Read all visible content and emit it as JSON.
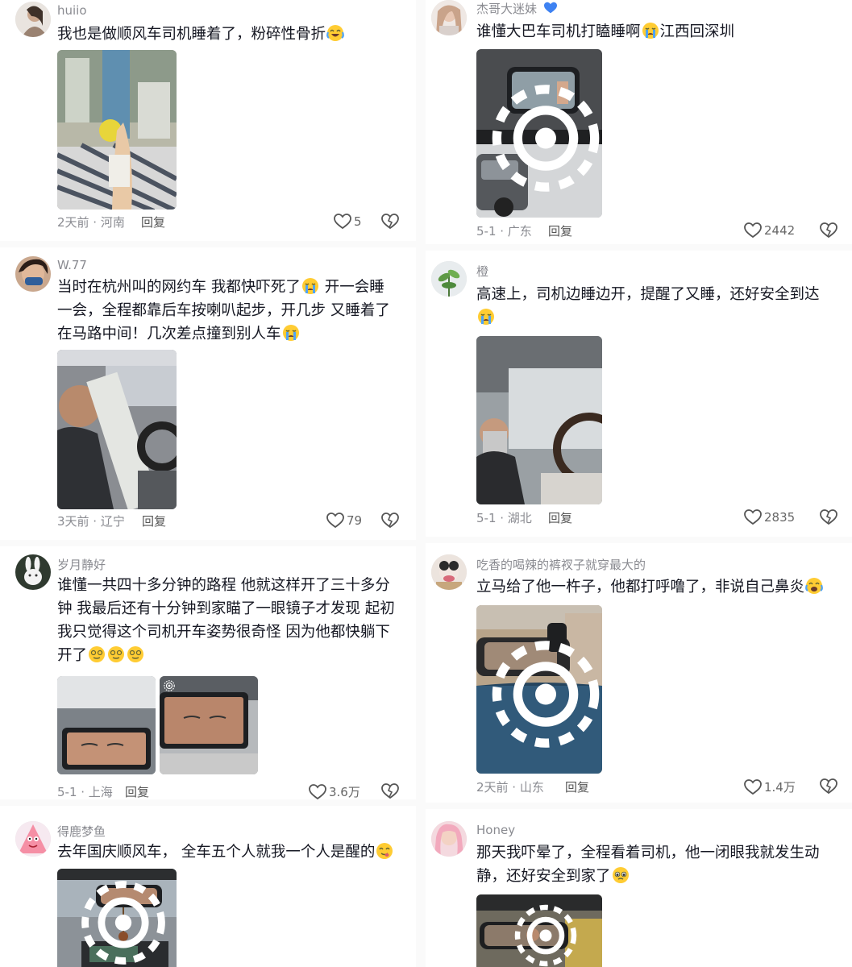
{
  "comments": [
    {
      "user": "huiio",
      "text": "我也是做顺风车司机睡着了，粉碎性骨折",
      "time": "2天前 · 河南",
      "reply": "回复",
      "likes": "5"
    },
    {
      "user": "W.77",
      "text": "当时在杭州叫的网约车 我都快吓死了",
      "text2": " 开一会睡一会，全程都靠后车按喇叭起步，开几步 又睡着了 在马路中间！几次差点撞到别人车",
      "time": "3天前 · 辽宁",
      "reply": "回复",
      "likes": "79"
    },
    {
      "user": "岁月静好",
      "text": "谁懂一共四十多分钟的路程 他就这样开了三十多分钟 我最后还有十分钟到家瞄了一眼镜子才发现 起初我只觉得这个司机开车姿势很奇怪 因为他都快躺下开了",
      "time": "5-1 · 上海",
      "reply": "回复",
      "likes": "3.6万"
    },
    {
      "user": "得鹿梦鱼",
      "text": "去年国庆顺风车， 全车五个人就我一个人是醒的"
    },
    {
      "user": "杰哥大迷妹",
      "text": "谁懂大巴车司机打瞌睡啊",
      "text2": "江西回深圳",
      "time": "5-1 · 广东",
      "reply": "回复",
      "likes": "2442"
    },
    {
      "user": "橙",
      "text": "高速上，司机边睡边开，提醒了又睡，还好安全到达",
      "time": "5-1 · 湖北",
      "reply": "回复",
      "likes": "2835"
    },
    {
      "user": "吃香的喝辣的裤衩子就穿最大的",
      "text": "立马给了他一杵子，他都打呼噜了，非说自己鼻炎",
      "time": "2天前 · 山东",
      "reply": "回复",
      "likes": "1.4万"
    },
    {
      "user": "Honey",
      "text": "那天我吓晕了，全程看着司机，他一闭眼我就发生动静，还好安全到家了"
    }
  ],
  "colors": {
    "text": "#161823",
    "meta": "#8a8b91",
    "background": "#ffffff"
  },
  "icons": {
    "like": "heart-outline-icon",
    "dislike": "broken-heart-icon",
    "live": "live-photo-icon"
  }
}
